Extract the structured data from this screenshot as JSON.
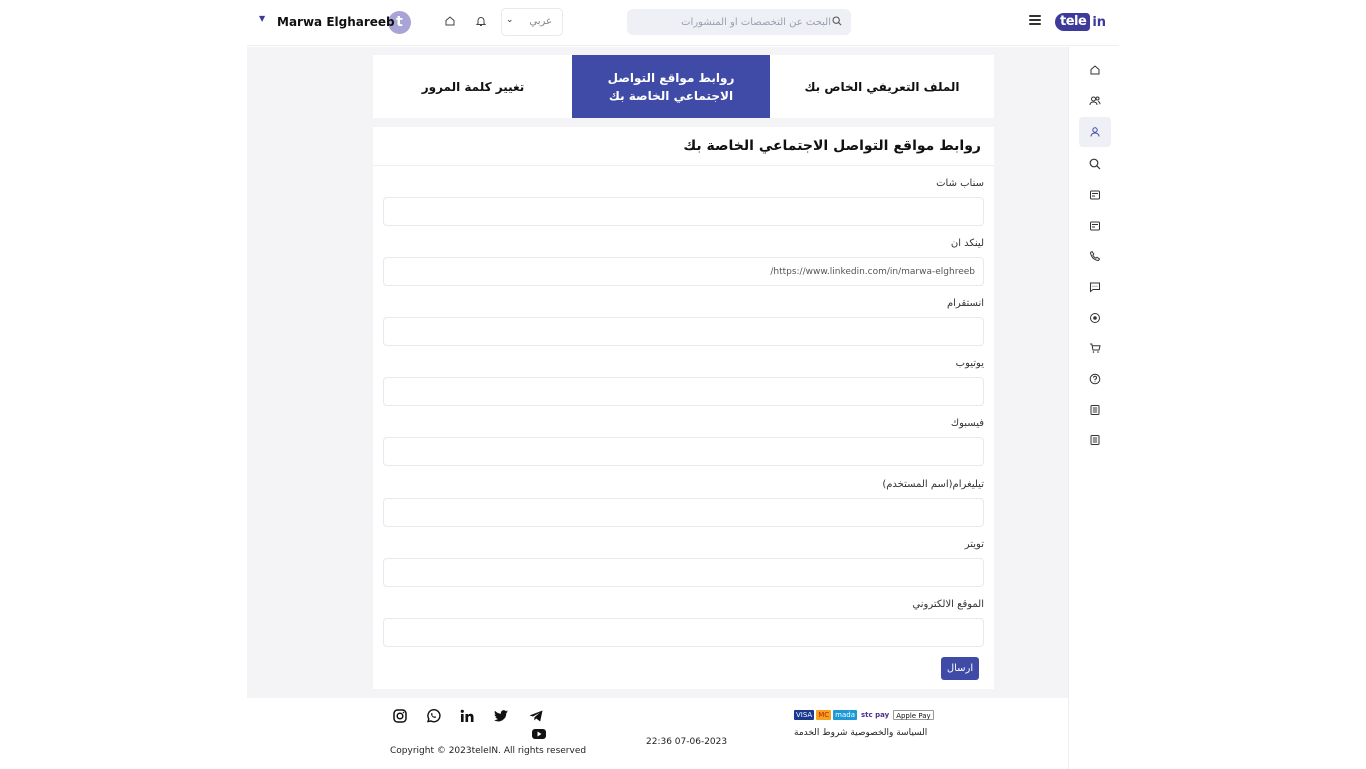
{
  "header": {
    "logo_part1": "tele",
    "logo_part2": "in",
    "search_placeholder": "البحث عن التخصصات او المنشورات",
    "language": "عربي",
    "avatar_letter": "t",
    "username": "Marwa Elghareeb"
  },
  "tabs": [
    {
      "label": "الملف التعريفي الخاص بك",
      "active": false
    },
    {
      "label": "روابط مواقع التواصل الاجتماعي الخاصة بك",
      "active": true
    },
    {
      "label": "تغيير كلمة المرور",
      "active": false
    }
  ],
  "form": {
    "title": "روابط مواقع التواصل الاجتماعي الخاصة بك",
    "fields": [
      {
        "label": "سناب شات",
        "value": ""
      },
      {
        "label": "لينكد ان",
        "value": "https://www.linkedin.com/in/marwa-elghreeb/"
      },
      {
        "label": "انستقرام",
        "value": ""
      },
      {
        "label": "يوتيوب",
        "value": ""
      },
      {
        "label": "فيسبوك",
        "value": ""
      },
      {
        "label": "تيليغرام(اسم المستخدم)",
        "value": ""
      },
      {
        "label": "تويتر",
        "value": ""
      },
      {
        "label": "الموقع الالكتروني",
        "value": ""
      }
    ],
    "submit_label": "ارسال"
  },
  "footer": {
    "copyright": "Copyright © 2023teleIN. All rights reserved",
    "datetime": "22:36 07-06-2023",
    "policy": "السياسة والخصوصية شروط الخدمة",
    "payment_methods": [
      "VISA",
      "MC",
      "mada",
      "stc pay",
      "Apple Pay"
    ]
  },
  "sidebar": {
    "items": [
      "home-icon",
      "users-icon",
      "profile-icon",
      "search-icon",
      "news-icon",
      "news-alt-icon",
      "phone-icon",
      "chat-icon",
      "target-icon",
      "cart-icon",
      "help-icon",
      "list-icon",
      "list-alt-icon"
    ],
    "active_index": 2
  },
  "colors": {
    "brand": "#3d3a9a",
    "active_tab": "#3f4ba7",
    "background": "#f4f4f6"
  }
}
